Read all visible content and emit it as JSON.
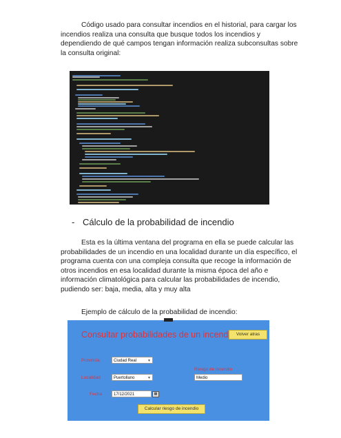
{
  "intro_paragraph": "Código usado para consultar incendios en el historial, para cargar los incendios realiza una consulta que busque todos los incendios y dependiendo de qué campos tengan información realiza subconsultas sobre la consulta original:",
  "section_heading": {
    "bullet": "-",
    "text": "Cálculo de la probabilidad de incendio"
  },
  "body_paragraph": "Esta es la última ventana del programa en ella se puede calcular las probabilidades de un incendio en una localidad durante un día específico, el programa cuenta con una compleja consulta que recoge la información de otros incendios en esa localidad durante la misma época del año e información climatológica para calcular las probabilidades de incendio, pudiendo ser: baja, media, alta y muy alta",
  "example_caption": "Ejemplo de cálculo de la probabilidad de incendio:",
  "app_window": {
    "title": "Consultar probabilidades de un incendio",
    "back_button": "Volver atras",
    "province_label": "Provincia",
    "province_value": "Ciudad Real",
    "locality_label": "Localidad",
    "locality_value": "Puertollano",
    "date_label": "Fecha",
    "date_value": "17/12/2021",
    "risk_label": "Riesgo de incendio",
    "risk_value": "Medio",
    "calculate_button": "Calcular riesgo de incendio",
    "background_color": "#4a90e2",
    "accent_color": "#e0323a",
    "button_color": "#f3e36c"
  },
  "code_screenshot": {
    "background_color": "#1a1a1a"
  }
}
